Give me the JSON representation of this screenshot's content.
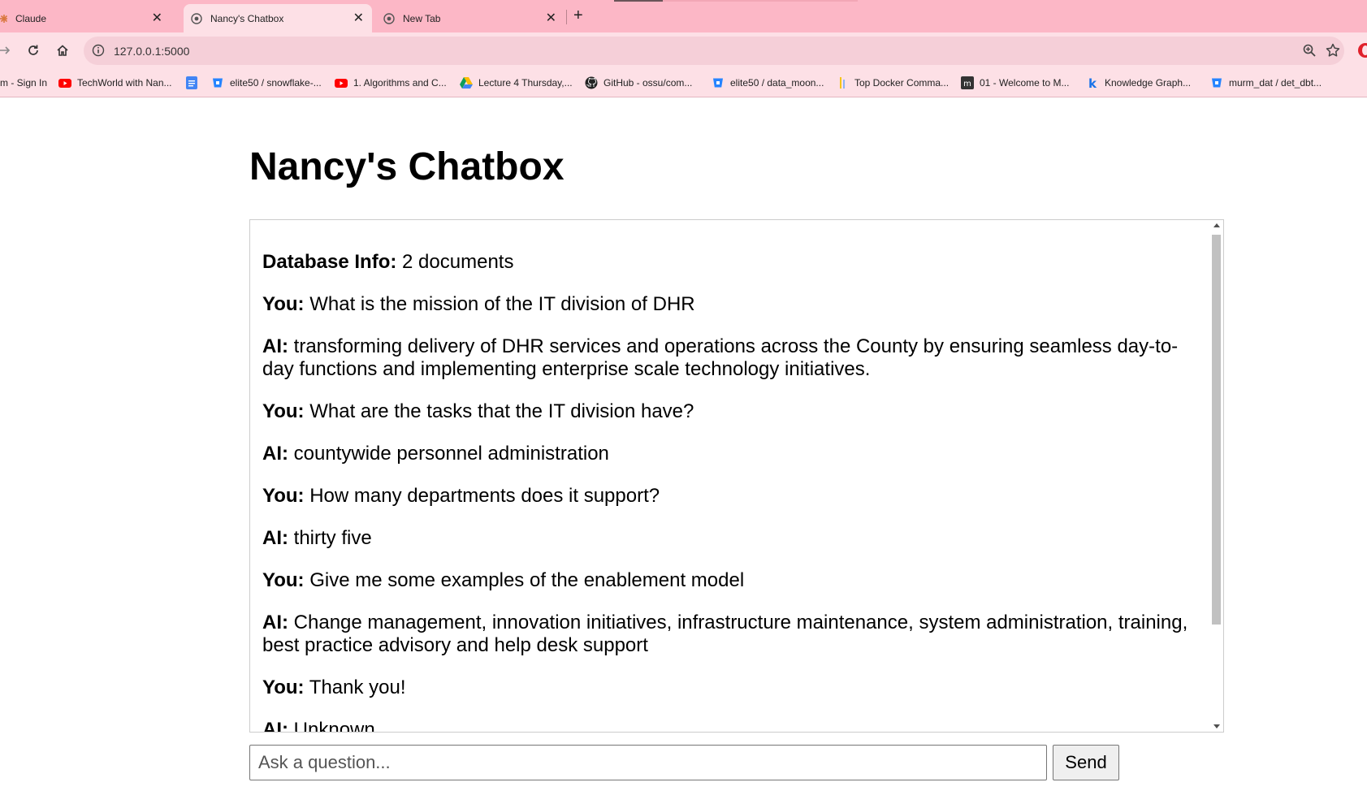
{
  "browser": {
    "tabs": [
      {
        "label": "Claude",
        "icon": "claude-icon",
        "active": false
      },
      {
        "label": "Nancy's Chatbox",
        "icon": "globe-icon",
        "active": true
      },
      {
        "label": "New Tab",
        "icon": "chrome-icon",
        "active": false
      }
    ],
    "close_glyph": "✕",
    "new_tab_glyph": "+",
    "url": "127.0.0.1:5000",
    "bookmarks": [
      {
        "label": "m - Sign In",
        "icon": "none"
      },
      {
        "label": "TechWorld with Nan...",
        "icon": "youtube-icon"
      },
      {
        "label": "elite50 / snowflake-...",
        "icon": "bitbucket-icon"
      },
      {
        "label": "1. Algorithms and C...",
        "icon": "youtube-icon"
      },
      {
        "label": "Lecture 4 Thursday,...",
        "icon": "drive-icon"
      },
      {
        "label": "GitHub - ossu/com...",
        "icon": "github-icon"
      },
      {
        "label": "elite50 / data_moon...",
        "icon": "bitbucket-icon"
      },
      {
        "label": "Top Docker Comma...",
        "icon": "docker-icon"
      },
      {
        "label": "01 - Welcome to M...",
        "icon": "m-icon"
      },
      {
        "label": "Knowledge Graph...",
        "icon": "k-icon"
      },
      {
        "label": "murm_dat / det_dbt...",
        "icon": "bitbucket-icon"
      }
    ],
    "colors": {
      "tabstrip": "#fcb7c6",
      "toolbar": "#fde0e6"
    }
  },
  "page": {
    "title": "Nancy's Chatbox"
  },
  "chat": {
    "messages": [
      {
        "speaker": "Database Info:",
        "text": " 2 documents"
      },
      {
        "speaker": "You:",
        "text": " What is the mission of the IT division of DHR"
      },
      {
        "speaker": "AI:",
        "text": " transforming delivery of DHR services and operations across the County by ensuring seamless day-to-day functions and implementing enterprise scale technology initiatives."
      },
      {
        "speaker": "You:",
        "text": " What are the tasks that the IT division have?"
      },
      {
        "speaker": "AI:",
        "text": " countywide personnel administration"
      },
      {
        "speaker": "You:",
        "text": " How many departments does it support?"
      },
      {
        "speaker": "AI:",
        "text": " thirty five"
      },
      {
        "speaker": "You:",
        "text": " Give me some examples of the enablement model"
      },
      {
        "speaker": "AI:",
        "text": " Change management, innovation initiatives, infrastructure maintenance, system administration, training, best practice advisory and help desk support"
      },
      {
        "speaker": "You:",
        "text": " Thank you!"
      },
      {
        "speaker": "AI:",
        "text": " Unknown"
      }
    ]
  },
  "input": {
    "placeholder": "Ask a question...",
    "value": ""
  },
  "send_button": {
    "label": "Send"
  }
}
